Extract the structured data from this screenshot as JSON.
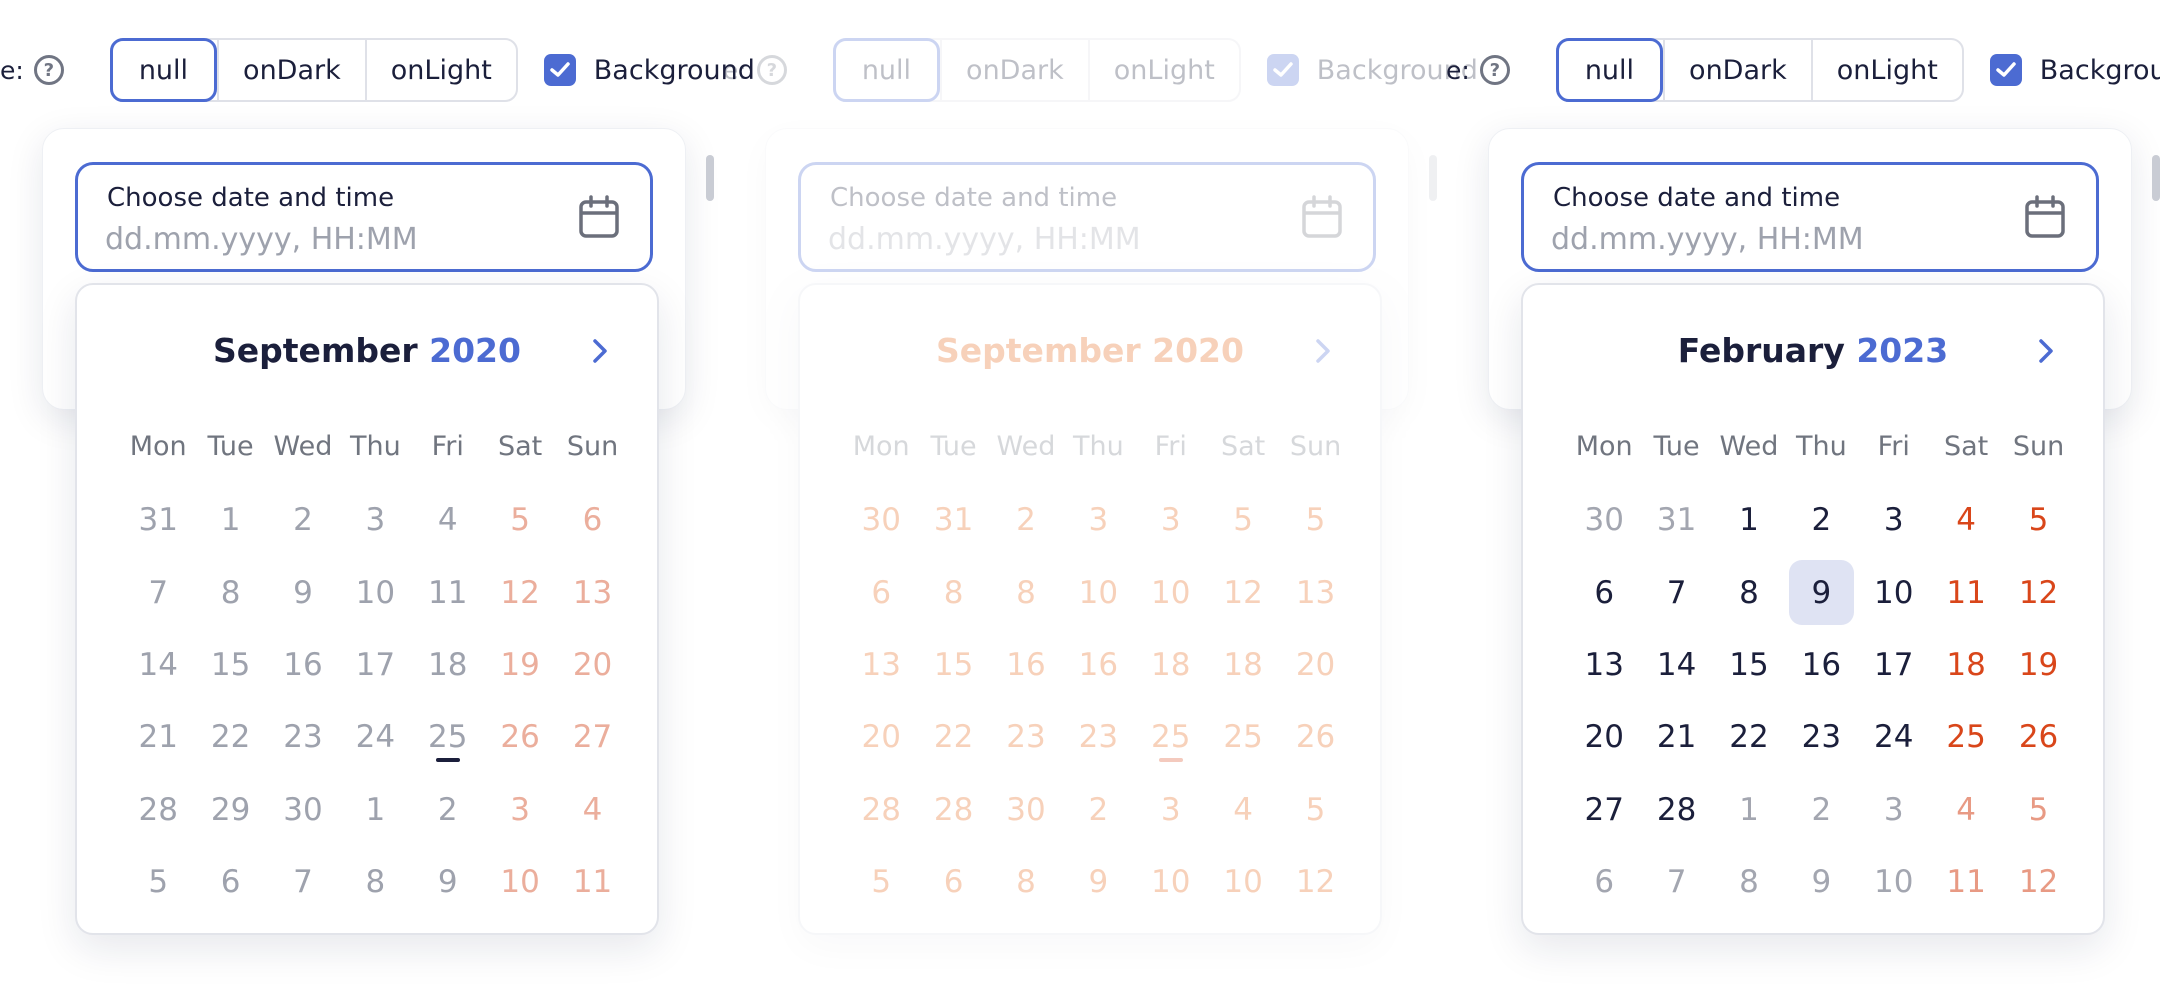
{
  "panels": [
    {
      "toolbar": {
        "mode_label": "e:",
        "segments": [
          "null",
          "onDark",
          "onLight"
        ],
        "active_segment": "null",
        "background_label": "Background",
        "background_checked": true
      },
      "field": {
        "label": "Choose date and time",
        "placeholder": "dd.mm.yyyy, HH:MM"
      },
      "calendar": {
        "month": "September",
        "year": "2020",
        "weekdays": [
          "Mon",
          "Tue",
          "Wed",
          "Thu",
          "Fri",
          "Sat",
          "Sun"
        ],
        "weeks": [
          [
            "31",
            "1",
            "2",
            "3",
            "4",
            "5",
            "6"
          ],
          [
            "7",
            "8",
            "9",
            "10",
            "11",
            "12",
            "13"
          ],
          [
            "14",
            "15",
            "16",
            "17",
            "18",
            "19",
            "20"
          ],
          [
            "21",
            "22",
            "23",
            "24",
            "25",
            "26",
            "27"
          ],
          [
            "28",
            "29",
            "30",
            "1",
            "2",
            "3",
            "4"
          ],
          [
            "5",
            "6",
            "7",
            "8",
            "9",
            "10",
            "11"
          ]
        ],
        "outside_range": [
          [
            0,
            0
          ],
          [
            4,
            3
          ],
          [
            4,
            4
          ],
          [
            4,
            5
          ],
          [
            4,
            6
          ],
          [
            5,
            0
          ],
          [
            5,
            1
          ],
          [
            5,
            2
          ],
          [
            5,
            3
          ],
          [
            5,
            4
          ],
          [
            5,
            5
          ],
          [
            5,
            6
          ]
        ],
        "today": [
          3,
          4
        ],
        "selected": null
      }
    },
    {
      "toolbar": {
        "mode_label": "e:",
        "segments": [
          "null",
          "onDark",
          "onLight"
        ],
        "active_segment": "null",
        "background_label": "Background",
        "background_checked": true
      },
      "field": {
        "label": "Choose date and time",
        "placeholder": "dd.mm.yyyy, HH:MM"
      },
      "calendar": {
        "month": "September",
        "year": "2020",
        "weekdays": [
          "Mon",
          "Tue",
          "Wed",
          "Thu",
          "Fri",
          "Sat",
          "Sun"
        ],
        "weeks": [
          [
            "30",
            "31",
            "2",
            "3",
            "3",
            "5",
            "5"
          ],
          [
            "6",
            "8",
            "8",
            "10",
            "10",
            "12",
            "13"
          ],
          [
            "13",
            "15",
            "16",
            "16",
            "18",
            "18",
            "20"
          ],
          [
            "20",
            "22",
            "23",
            "23",
            "25",
            "25",
            "26"
          ],
          [
            "28",
            "28",
            "30",
            "2",
            "3",
            "4",
            "5"
          ],
          [
            "5",
            "6",
            "8",
            "9",
            "10",
            "10",
            "12"
          ]
        ],
        "outside_range": [],
        "today": [
          3,
          4
        ],
        "selected": null
      }
    },
    {
      "toolbar": {
        "mode_label": "e:",
        "segments": [
          "null",
          "onDark",
          "onLight"
        ],
        "active_segment": "null",
        "background_label": "Background",
        "background_checked": true
      },
      "field": {
        "label": "Choose date and time",
        "placeholder": "dd.mm.yyyy, HH:MM"
      },
      "calendar": {
        "month": "February",
        "year": "2023",
        "weekdays": [
          "Mon",
          "Tue",
          "Wed",
          "Thu",
          "Fri",
          "Sat",
          "Sun"
        ],
        "weeks": [
          [
            "30",
            "31",
            "1",
            "2",
            "3",
            "4",
            "5"
          ],
          [
            "6",
            "7",
            "8",
            "9",
            "10",
            "11",
            "12"
          ],
          [
            "13",
            "14",
            "15",
            "16",
            "17",
            "18",
            "19"
          ],
          [
            "20",
            "21",
            "22",
            "23",
            "24",
            "25",
            "26"
          ],
          [
            "27",
            "28",
            "1",
            "2",
            "3",
            "4",
            "5"
          ],
          [
            "6",
            "7",
            "8",
            "9",
            "10",
            "11",
            "12"
          ]
        ],
        "outside_range": [
          [
            0,
            0
          ],
          [
            0,
            1
          ],
          [
            4,
            2
          ],
          [
            4,
            3
          ],
          [
            4,
            4
          ],
          [
            4,
            5
          ],
          [
            4,
            6
          ],
          [
            5,
            0
          ],
          [
            5,
            1
          ],
          [
            5,
            2
          ],
          [
            5,
            3
          ],
          [
            5,
            4
          ],
          [
            5,
            5
          ],
          [
            5,
            6
          ]
        ],
        "today": null,
        "selected": [
          1,
          3
        ]
      }
    }
  ],
  "colors": {
    "accent": "#4c6bd2",
    "weekend": "#d9461a",
    "text": "#1b1f3b",
    "muted": "#a3a6b0",
    "selected_bg": "#dfe3f3"
  },
  "icons": {
    "help": "help-circle-icon",
    "checkbox": "checkmark-icon",
    "field": "calendar-icon",
    "next": "chevron-right-icon"
  }
}
